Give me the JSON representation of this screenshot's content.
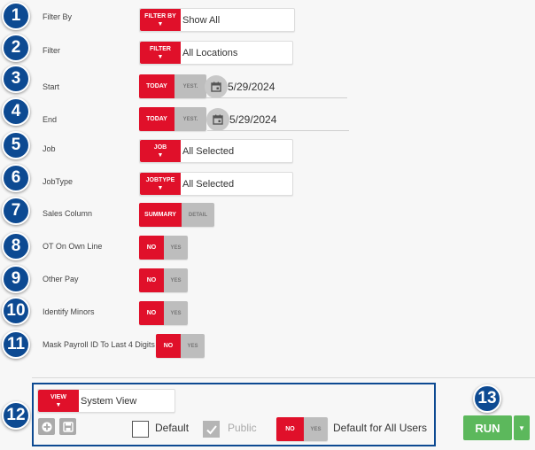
{
  "callouts": [
    "1",
    "2",
    "3",
    "4",
    "5",
    "6",
    "7",
    "8",
    "9",
    "10",
    "11",
    "12",
    "13"
  ],
  "fields": {
    "filter_by": {
      "label": "Filter By",
      "tag": "FILTER BY",
      "value": "Show All"
    },
    "filter": {
      "label": "Filter",
      "tag": "FILTER",
      "value": "All Locations"
    },
    "start": {
      "label": "Start",
      "today": "TODAY",
      "yest": "YEST.",
      "value": "5/29/2024"
    },
    "end": {
      "label": "End",
      "today": "TODAY",
      "yest": "YEST.",
      "value": "5/29/2024"
    },
    "job": {
      "label": "Job",
      "tag": "JOB",
      "value": "All Selected"
    },
    "jobtype": {
      "label": "JobType",
      "tag": "JOBTYPE",
      "value": "All Selected"
    },
    "sales_column": {
      "label": "Sales Column",
      "on": "SUMMARY",
      "off": "DETAIL"
    },
    "ot_own_line": {
      "label": "OT On Own Line",
      "on": "NO",
      "off": "YES"
    },
    "other_pay": {
      "label": "Other Pay",
      "on": "NO",
      "off": "YES"
    },
    "identify_minors": {
      "label": "Identify Minors",
      "on": "NO",
      "off": "YES"
    },
    "mask_payroll": {
      "label": "Mask Payroll ID To Last 4 Digits",
      "on": "NO",
      "off": "YES"
    }
  },
  "view": {
    "tag": "VIEW",
    "value": "System View",
    "default_label": "Default",
    "public_label": "Public",
    "all_users_on": "NO",
    "all_users_off": "YES",
    "all_users_label": "Default for All Users"
  },
  "run": {
    "label": "RUN"
  },
  "icons": {
    "calendar": "calendar-icon",
    "add": "add-circle-icon",
    "save": "floppy-disk-icon",
    "check": "checkmark-icon",
    "dropdown": "caret-down-icon"
  },
  "colors": {
    "accent": "#e0102a",
    "callout": "#0d4a92",
    "run": "#5cb85c"
  }
}
